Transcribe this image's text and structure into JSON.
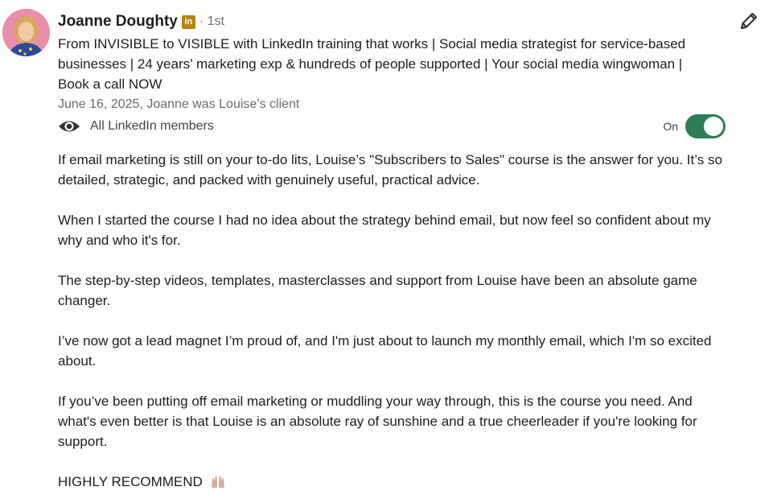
{
  "profile": {
    "name": "Joanne Doughty",
    "badge_text": "in",
    "degree": "· 1st",
    "headline": "From INVISIBLE to VISIBLE with LinkedIn training that works | Social media strategist for service-based businesses | 24 years’ marketing exp & hundreds of people supported | Your social media wingwoman | Book a call NOW",
    "meta": "June 16, 2025, Joanne was Louise’s client"
  },
  "visibility": {
    "label": "All LinkedIn members",
    "toggle_label": "On",
    "toggle_on": true,
    "toggle_color": "#2f7d55"
  },
  "badge_color": "#b8860b",
  "paragraphs": [
    "If email marketing is still on your to-do lits, Louise’s \"Subscribers to Sales\" course is the answer for you. It’s so detailed, strategic, and packed with genuinely useful, practical advice.",
    "When I started the course I had no idea about the strategy behind email, but now feel so confident about my why and who it's for.",
    "The step-by-step videos, templates, masterclasses and support from Louise have been an absolute game changer.",
    "I’ve now got a lead magnet I’m proud of, and I'm just about to launch my monthly email, which I'm so excited about.",
    "If you’ve been putting off email marketing or muddling your way through, this is the course you need. And what's even better is that Louise is an absolute ray of sunshine and a true cheerleader if you're looking for support."
  ],
  "closing": "HIGHLY RECOMMEND",
  "icons": {
    "edit": "pencil-icon",
    "visibility": "eye-icon",
    "emoji": "raising-hands-emoji"
  }
}
